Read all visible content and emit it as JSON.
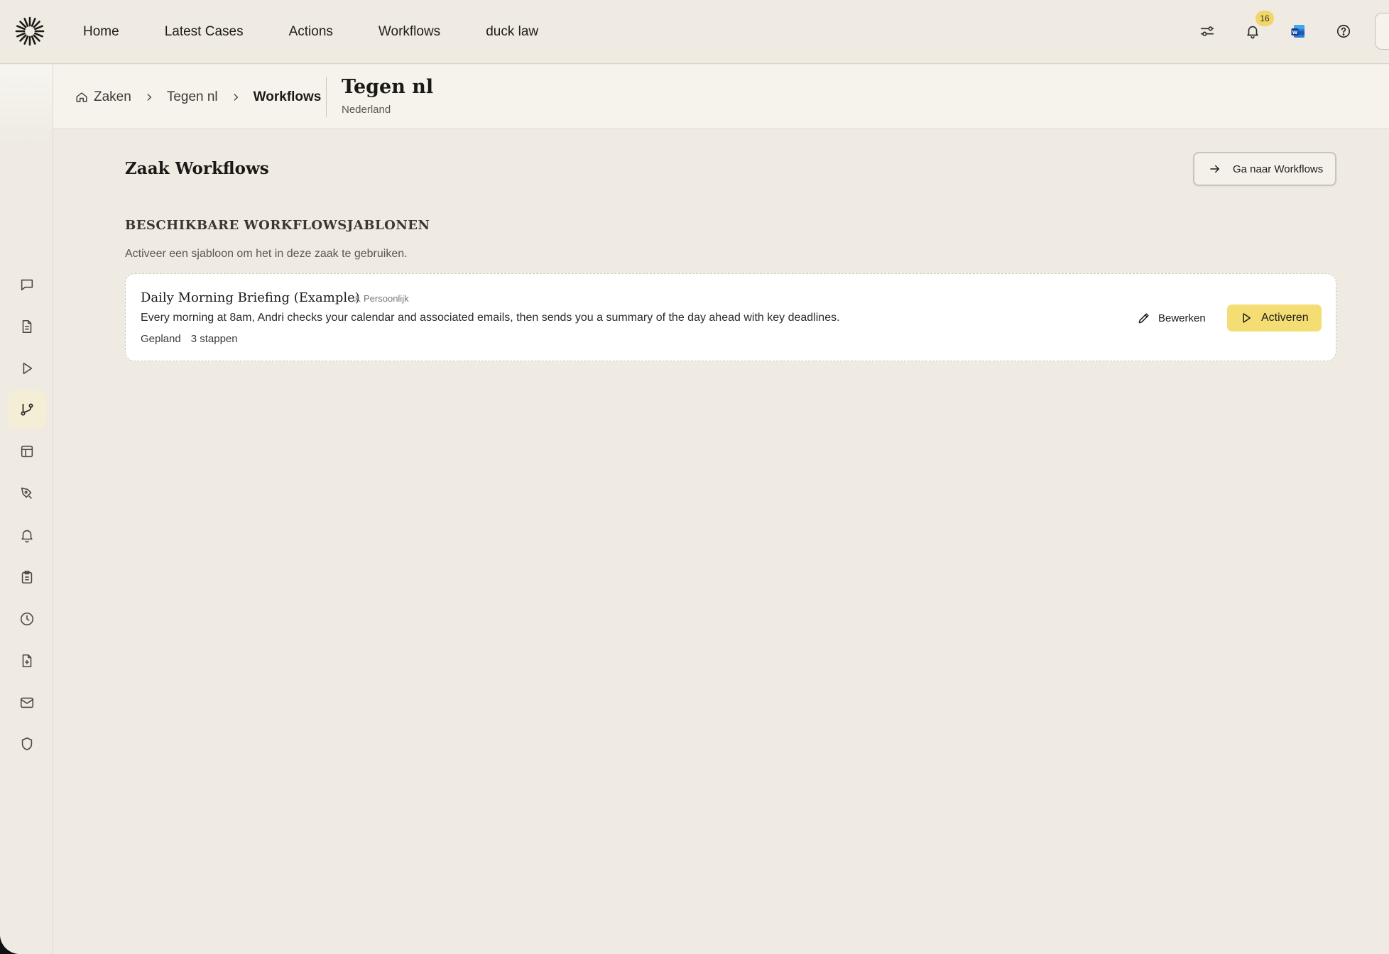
{
  "topnav": {
    "items": [
      "Home",
      "Latest Cases",
      "Actions",
      "Workflows",
      "duck law"
    ],
    "notifications_count": "16",
    "icons": [
      "sliders-icon",
      "bell-icon",
      "word-app-icon",
      "help-icon"
    ]
  },
  "breadcrumb": {
    "items": [
      "Zaken",
      "Tegen nl",
      "Workflows"
    ]
  },
  "case": {
    "title": "Tegen nl",
    "jurisdiction": "Nederland"
  },
  "main": {
    "title": "Zaak Workflows",
    "goto_button": "Ga naar Workflows",
    "section_title": "BESCHIKBARE WORKFLOWSJABLONEN",
    "section_subtitle": "Activeer een sjabloon om het in deze zaak te gebruiken.",
    "templates": [
      {
        "title": "Daily Morning Briefing (Example)",
        "tag": "Persoonlijk",
        "description": "Every morning at 8am, Andri checks your calendar and associated emails, then sends you a summary of the day ahead with key deadlines.",
        "schedule": "Gepland",
        "steps": "3 stappen",
        "edit_label": "Bewerken",
        "activate_label": "Activeren"
      }
    ]
  },
  "sidebar": {
    "icons": [
      "chat-icon",
      "document-icon",
      "play-icon",
      "workflow-icon",
      "table-icon",
      "pen-tool-icon",
      "bell-icon",
      "clipboard-icon",
      "clock-icon",
      "file-plus-icon",
      "mail-icon",
      "shield-icon"
    ],
    "active": "workflow-icon"
  },
  "colors": {
    "background": "#efebe3",
    "accent": "#f4dd72",
    "badge": "#f2d66a",
    "card": "#ffffff"
  }
}
